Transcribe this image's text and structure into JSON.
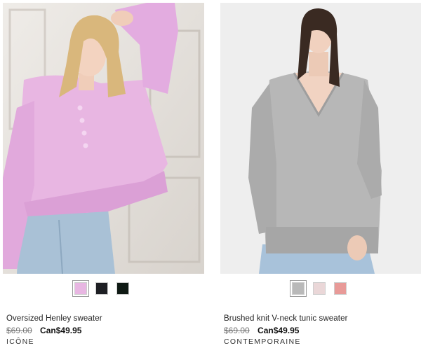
{
  "products": [
    {
      "name": "Oversized Henley sweater",
      "price_original": "$69.00",
      "price_sale": "Can$49.95",
      "brand": "ICÔNE",
      "image_alt": "model in pink Henley sweater",
      "swatches": [
        {
          "color": "#e8b6e2",
          "name": "pink",
          "selected": true
        },
        {
          "color": "#1e1f24",
          "name": "black",
          "selected": false
        },
        {
          "color": "#0f1a14",
          "name": "dark green",
          "selected": false
        }
      ]
    },
    {
      "name": "Brushed knit V-neck tunic sweater",
      "price_original": "$69.00",
      "price_sale": "Can$49.95",
      "brand": "CONTEMPORAINE",
      "image_alt": "model in grey V-neck tunic sweater",
      "swatches": [
        {
          "color": "#b9b9b9",
          "name": "grey",
          "selected": true
        },
        {
          "color": "#ead7d8",
          "name": "light pink",
          "selected": false
        },
        {
          "color": "#e89a98",
          "name": "coral",
          "selected": false
        }
      ]
    }
  ]
}
